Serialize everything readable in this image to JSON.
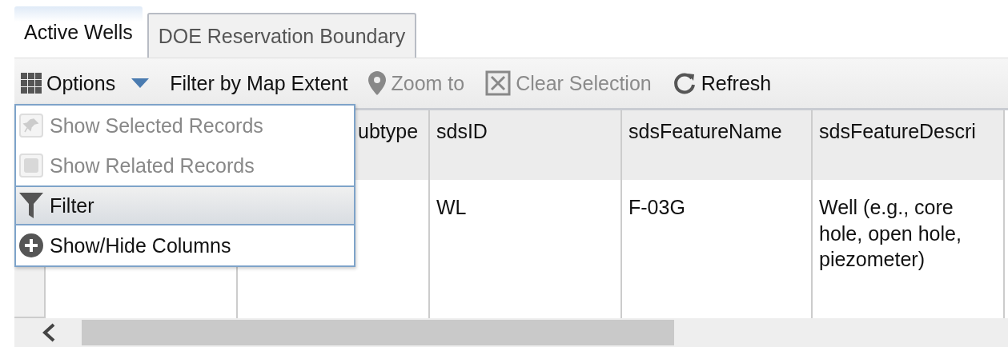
{
  "tabs": [
    {
      "label": "Active Wells",
      "selected": true
    },
    {
      "label": "DOE Reservation Boundary",
      "selected": false
    }
  ],
  "toolbar": [
    {
      "kind": "options",
      "label": "Options",
      "disabled": false
    },
    {
      "kind": "plain",
      "label": "Filter by Map Extent",
      "disabled": false
    },
    {
      "kind": "zoom",
      "label": "Zoom to",
      "disabled": true
    },
    {
      "kind": "clear",
      "label": "Clear Selection",
      "disabled": true
    },
    {
      "kind": "refresh",
      "label": "Refresh",
      "disabled": false
    }
  ],
  "options_menu": [
    {
      "kind": "pin",
      "label": "Show Selected Records",
      "disabled": true,
      "selected": false
    },
    {
      "kind": "related",
      "label": "Show Related Records",
      "disabled": true,
      "selected": false
    },
    {
      "kind": "filter",
      "label": "Filter",
      "disabled": false,
      "selected": true
    },
    {
      "kind": "columns",
      "label": "Show/Hide Columns",
      "disabled": false,
      "selected": false
    }
  ],
  "table": {
    "columns": [
      "ubtype",
      "sdsID",
      "sdsFeatureName",
      "sdsFeatureDescri"
    ],
    "rows": [
      [
        "",
        "WL",
        "F-03G",
        "Well (e.g., core hole, open hole, piezometer)"
      ]
    ]
  }
}
